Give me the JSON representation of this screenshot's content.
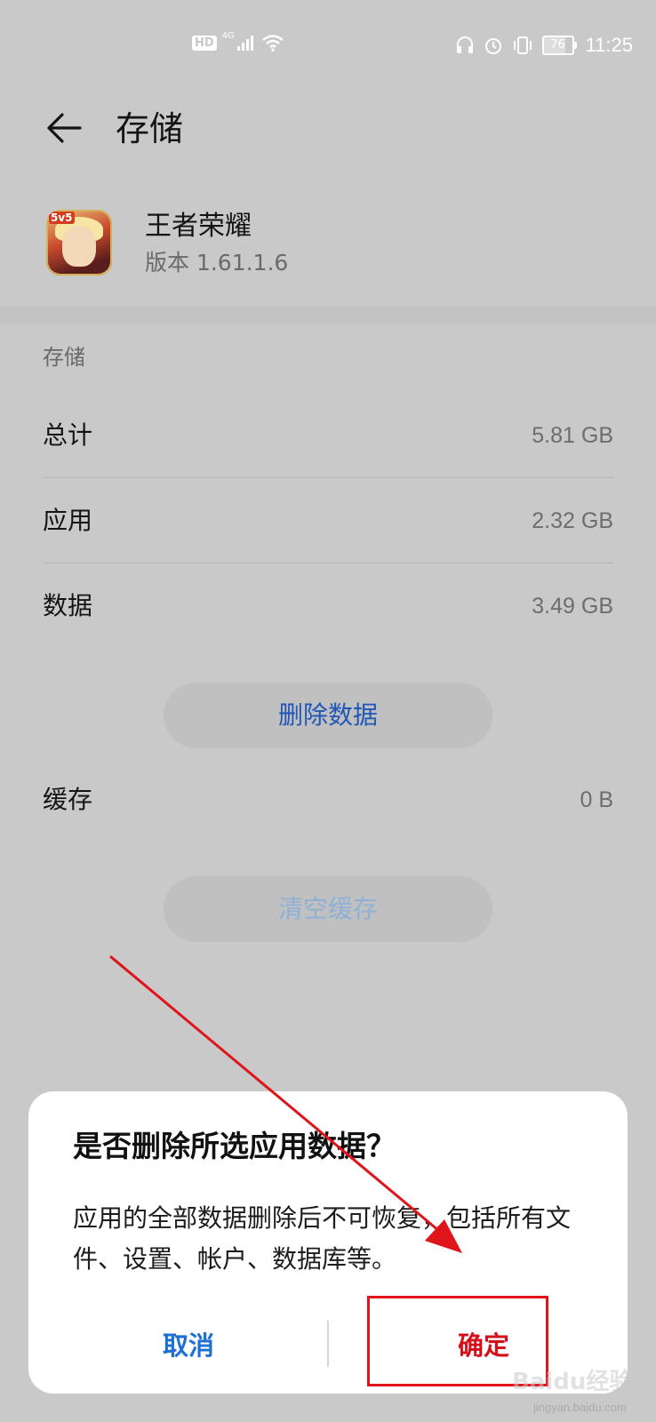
{
  "status_bar": {
    "left_badge": "HD",
    "network": "4G",
    "battery": "76",
    "battery_level": 0.76,
    "time": "11:25"
  },
  "header": {
    "title": "存储",
    "back_icon": "arrow-left-icon"
  },
  "app": {
    "name": "王者荣耀",
    "version": "版本 1.61.1.6",
    "icon_tag": "5v5"
  },
  "storage": {
    "section_label": "存储",
    "rows": [
      {
        "label": "总计",
        "value": "5.81 GB"
      },
      {
        "label": "应用",
        "value": "2.32 GB"
      },
      {
        "label": "数据",
        "value": "3.49 GB"
      }
    ],
    "delete_data_label": "删除数据",
    "cache": {
      "label": "缓存",
      "value": "0 B"
    },
    "clear_cache_label": "清空缓存"
  },
  "dialog": {
    "title": "是否删除所选应用数据？",
    "body": "应用的全部数据删除后不可恢复，包括所有文件、设置、帐户、数据库等。",
    "cancel_label": "取消",
    "confirm_label": "确定"
  },
  "annotation": {
    "color": "#e0141b"
  },
  "watermark": {
    "brand": "Baidu经验",
    "url": "jingyan.baidu.com"
  }
}
